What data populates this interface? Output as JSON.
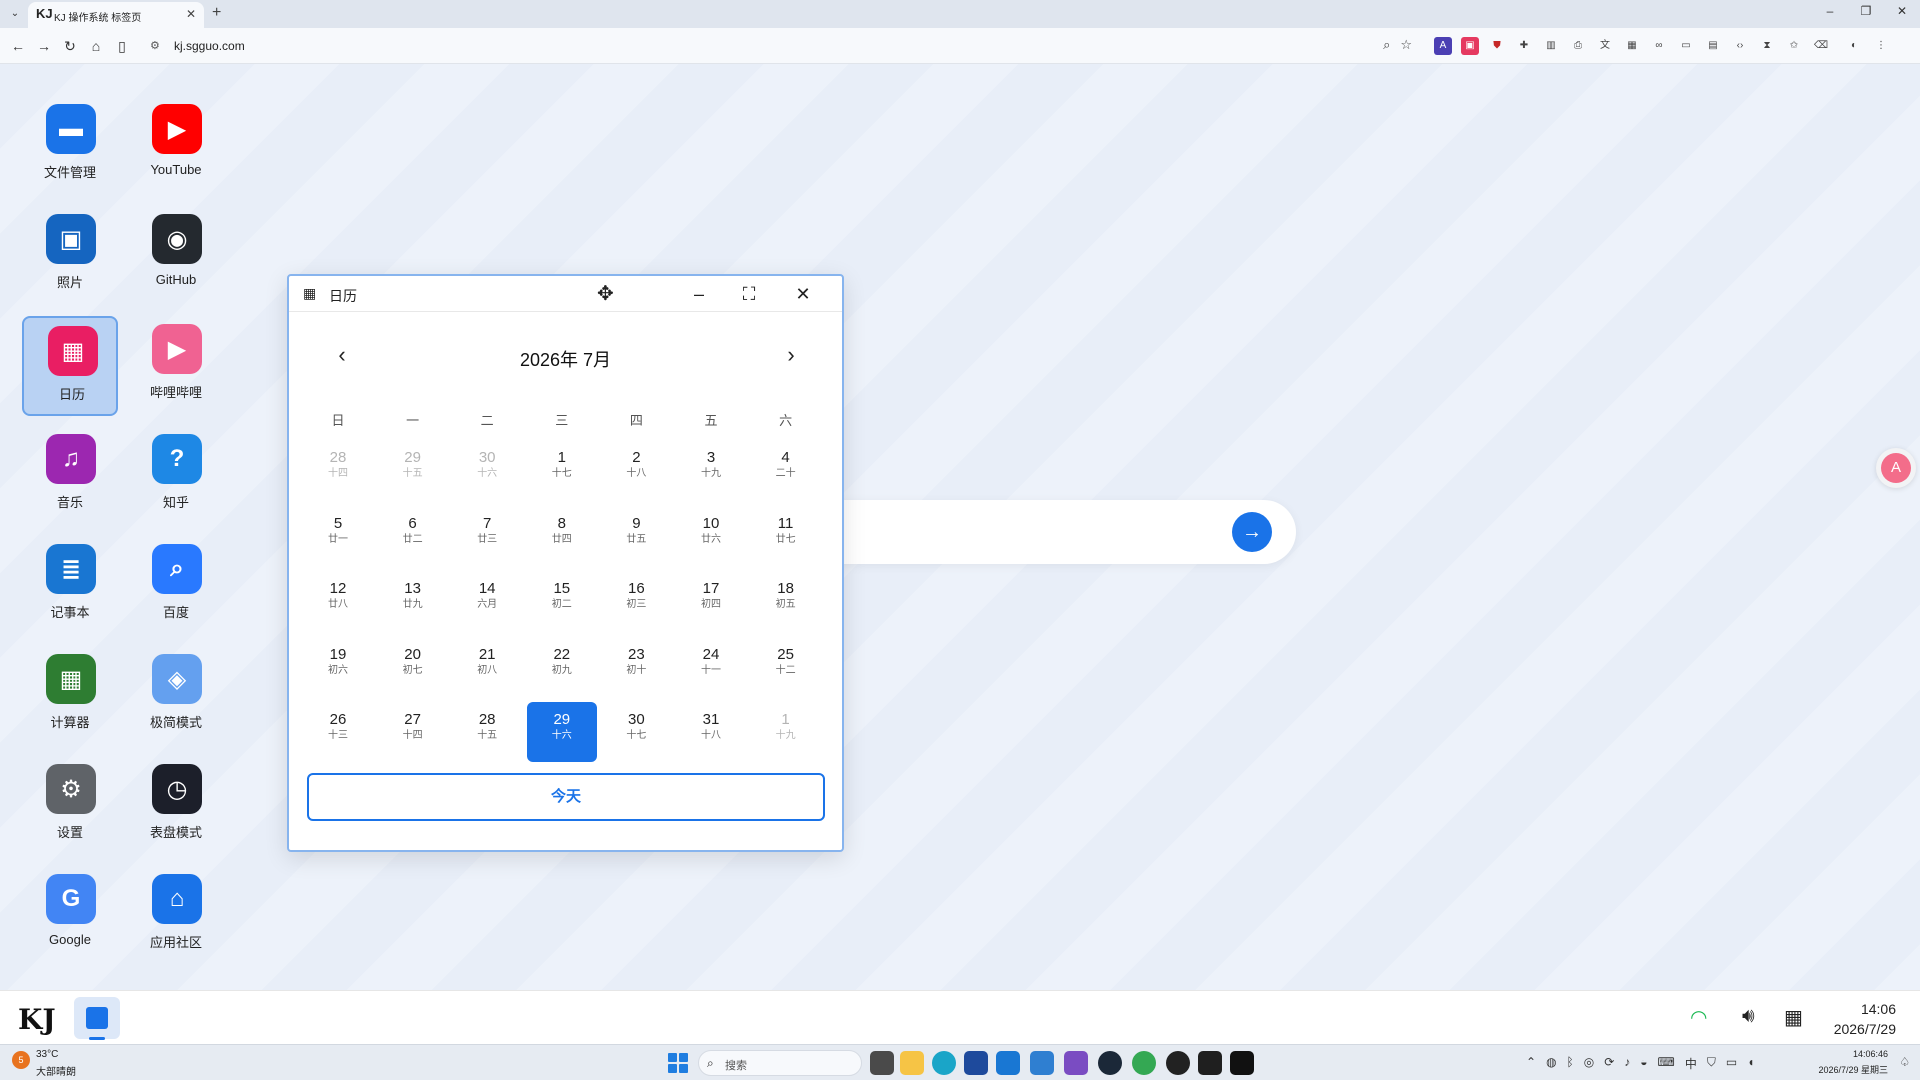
{
  "browser": {
    "tab_title": "KJ 操作系统 标签页",
    "tab_favicon": "KJ",
    "url": "kj.sgguo.com",
    "new_tab": "+",
    "tab_close": "✕"
  },
  "desktop": {
    "apps": [
      {
        "label": "文件管理",
        "icon": "folder-icon",
        "color": "#1a73e8",
        "glyph": "▬"
      },
      {
        "label": "YouTube",
        "icon": "youtube-icon",
        "color": "#ff0000",
        "glyph": "▶"
      },
      {
        "label": "照片",
        "icon": "photos-icon",
        "color": "#1565c0",
        "glyph": "▣"
      },
      {
        "label": "GitHub",
        "icon": "github-icon",
        "color": "#24292f",
        "glyph": "◉"
      },
      {
        "label": "日历",
        "icon": "calendar-icon",
        "color": "#e91e63",
        "glyph": "▦"
      },
      {
        "label": "哔哩哔哩",
        "icon": "bilibili-icon",
        "color": "#f06292",
        "glyph": "▶"
      },
      {
        "label": "音乐",
        "icon": "music-icon",
        "color": "#9c27b0",
        "glyph": "♫"
      },
      {
        "label": "知乎",
        "icon": "zhihu-icon",
        "color": "#1e88e5",
        "glyph": "?"
      },
      {
        "label": "记事本",
        "icon": "notepad-icon",
        "color": "#1976d2",
        "glyph": "≣"
      },
      {
        "label": "百度",
        "icon": "search-icon",
        "color": "#2979ff",
        "glyph": "⌕"
      },
      {
        "label": "计算器",
        "icon": "calculator-icon",
        "color": "#2e7d32",
        "glyph": "▦"
      },
      {
        "label": "极简模式",
        "icon": "cube-icon",
        "color": "#64a0ef",
        "glyph": "◈"
      },
      {
        "label": "设置",
        "icon": "gear-icon",
        "color": "#5f6368",
        "glyph": "⚙"
      },
      {
        "label": "表盘模式",
        "icon": "clock-icon",
        "color": "#1c1f2a",
        "glyph": "◷"
      },
      {
        "label": "Google",
        "icon": "google-icon",
        "color": "#4285f4",
        "glyph": "G"
      },
      {
        "label": "应用社区",
        "icon": "store-icon",
        "color": "#1a73e8",
        "glyph": "⌂"
      }
    ],
    "selected_app": "日历",
    "search_go": "→",
    "translate_glyph": "A"
  },
  "calendar": {
    "window_title": "日历",
    "month_label": "2026年 7月",
    "prev": "‹",
    "next": "›",
    "weekdays": [
      "日",
      "一",
      "二",
      "三",
      "四",
      "五",
      "六"
    ],
    "days": [
      {
        "d": "28",
        "l": "十四",
        "o": true
      },
      {
        "d": "29",
        "l": "十五",
        "o": true
      },
      {
        "d": "30",
        "l": "十六",
        "o": true
      },
      {
        "d": "1",
        "l": "十七"
      },
      {
        "d": "2",
        "l": "十八"
      },
      {
        "d": "3",
        "l": "十九"
      },
      {
        "d": "4",
        "l": "二十"
      },
      {
        "d": "5",
        "l": "廿一"
      },
      {
        "d": "6",
        "l": "廿二"
      },
      {
        "d": "7",
        "l": "廿三"
      },
      {
        "d": "8",
        "l": "廿四"
      },
      {
        "d": "9",
        "l": "廿五"
      },
      {
        "d": "10",
        "l": "廿六"
      },
      {
        "d": "11",
        "l": "廿七"
      },
      {
        "d": "12",
        "l": "廿八"
      },
      {
        "d": "13",
        "l": "廿九"
      },
      {
        "d": "14",
        "l": "六月"
      },
      {
        "d": "15",
        "l": "初二"
      },
      {
        "d": "16",
        "l": "初三"
      },
      {
        "d": "17",
        "l": "初四"
      },
      {
        "d": "18",
        "l": "初五"
      },
      {
        "d": "19",
        "l": "初六"
      },
      {
        "d": "20",
        "l": "初七"
      },
      {
        "d": "21",
        "l": "初八"
      },
      {
        "d": "22",
        "l": "初九"
      },
      {
        "d": "23",
        "l": "初十"
      },
      {
        "d": "24",
        "l": "十一"
      },
      {
        "d": "25",
        "l": "十二"
      },
      {
        "d": "26",
        "l": "十三"
      },
      {
        "d": "27",
        "l": "十四"
      },
      {
        "d": "28",
        "l": "十五"
      },
      {
        "d": "29",
        "l": "十六",
        "t": true
      },
      {
        "d": "30",
        "l": "十七"
      },
      {
        "d": "31",
        "l": "十八"
      },
      {
        "d": "1",
        "l": "十九",
        "o": true
      }
    ],
    "today_button": "今天"
  },
  "dock": {
    "logo": "KJ",
    "time": "14:06",
    "date": "2026/7/29"
  },
  "taskbar": {
    "weather_temp": "33°C",
    "weather_desc": "大部晴朗",
    "weather_badge": "5",
    "search_placeholder": "搜索",
    "time": "14:06:46",
    "date": "2026/7/29 星期三"
  }
}
